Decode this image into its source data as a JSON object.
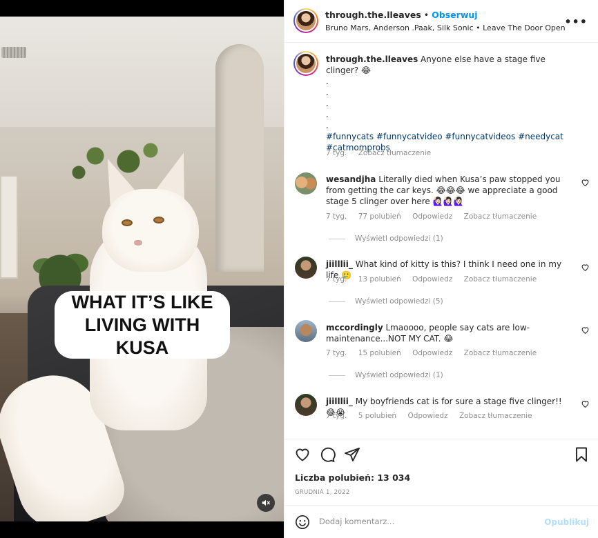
{
  "media": {
    "caption_line1": "WHAT IT’S LIKE",
    "caption_line2": "LIVING WITH KUSA",
    "mute_icon": "muted-speaker-icon"
  },
  "header": {
    "username": "through.the.lleaves",
    "separator": "•",
    "follow_label": "Obserwuj",
    "audio": "Bruno Mars, Anderson .Paak, Silk Sonic • Leave The Door Open",
    "more_icon": "more-options-icon"
  },
  "caption": {
    "username": "through.the.lleaves",
    "text": "Anyone else have a stage five clinger? 😂",
    "dots": [
      ".",
      ".",
      ".",
      ".",
      "."
    ],
    "hashtags": "#funnycats #funnycatvideo #funnycatvideos #needycat #catmomprobs",
    "time": "7 tyg.",
    "translate": "Zobacz tłumaczenie"
  },
  "comments": [
    {
      "username": "wesandjha",
      "text": "Literally died when Kusa’s paw stopped you from getting the car keys. 😂😂😂 we appreciate a good stage 5 clinger over here 🙋🏻‍♀️🙋🏻‍♀️🙋🏻‍♀️",
      "time": "7 tyg.",
      "likes": "77 polubień",
      "reply": "Odpowiedz",
      "translate": "Zobacz tłumaczenie",
      "view_replies": "Wyświetl odpowiedzi (1)"
    },
    {
      "username": "jiilllii_",
      "text": "What kind of kitty is this? I think I need one in my life 🥲",
      "time": "7 tyg.",
      "likes": "13 polubień",
      "reply": "Odpowiedz",
      "translate": "Zobacz tłumaczenie",
      "view_replies": "Wyświetl odpowiedzi (5)"
    },
    {
      "username": "mccordingly",
      "text": "Lmaoooo, people say cats are low-maintenance...NOT MY CAT. 😂",
      "time": "7 tyg.",
      "likes": "15 polubień",
      "reply": "Odpowiedz",
      "translate": "Zobacz tłumaczenie",
      "view_replies": "Wyświetl odpowiedzi (1)"
    },
    {
      "username": "jiilllii_",
      "text": "My boyfriends cat is for sure a stage five clinger!! 😂😭",
      "time": "7 tyg.",
      "likes": "5 polubień",
      "reply": "Odpowiedz",
      "translate": "Zobacz tłumaczenie"
    }
  ],
  "actions": {
    "like_icon": "heart-icon",
    "comment_icon": "comment-bubble-icon",
    "share_icon": "paper-plane-icon",
    "save_icon": "bookmark-icon",
    "likes_count": "Liczba polubień: 13 034",
    "date": "GRUDNIA 1, 2022"
  },
  "add_comment": {
    "emoji_icon": "emoji-smiley-icon",
    "placeholder": "Dodaj komentarz...",
    "publish_label": "Opublikuj"
  },
  "colors": {
    "link_blue": "#0095f6",
    "hashtag_blue": "#00376b",
    "muted_text": "#8e8e8e",
    "publish_disabled": "#b2dffc"
  }
}
